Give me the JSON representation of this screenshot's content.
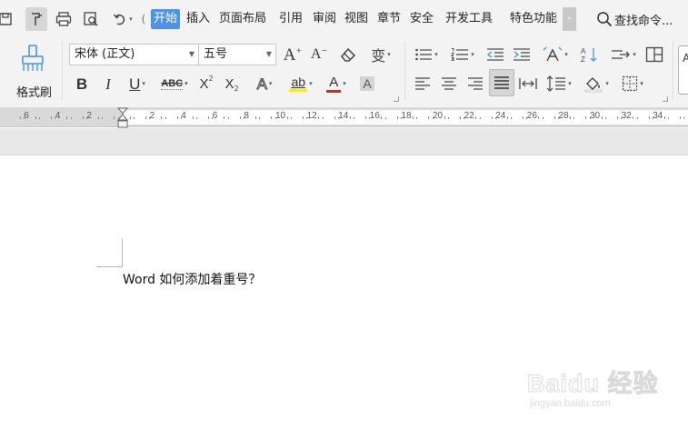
{
  "menubar": {
    "tabs": [
      "开始",
      "插入",
      "页面布局",
      "引用",
      "审阅",
      "视图",
      "章节",
      "安全",
      "开发工具",
      "特色功能"
    ],
    "active_tab": "开始",
    "search_label": "查找命令..."
  },
  "ribbon": {
    "format_painter_label": "格式刷",
    "font_name": "宋体 (正文)",
    "font_size": "五号",
    "glyphs": {
      "grow_font": "A",
      "shrink_font": "A",
      "bold": "B",
      "italic": "I",
      "underline": "U",
      "strike": "ABC",
      "superscript": "X",
      "superscript_mark": "2",
      "subscript": "X",
      "subscript_mark": "2",
      "text_effect": "A",
      "highlight": "ab",
      "font_color": "A",
      "char_shading": "A",
      "phonetic": "变"
    },
    "colors": {
      "font_color_bar": "#e02020",
      "highlight_bar": "#f6e733",
      "accent": "#4c93e8"
    }
  },
  "ruler": {
    "left_labels": [
      "6",
      "4",
      "2"
    ],
    "right_labels": [
      "2",
      "4",
      "6",
      "8",
      "10",
      "12",
      "14",
      "16",
      "18",
      "20",
      "22",
      "24",
      "26",
      "28",
      "30",
      "32",
      "34"
    ]
  },
  "document": {
    "text": "Word 如何添加着重号？"
  },
  "watermark": {
    "brand": "Baidu 经验",
    "url": "jingyan.baidu.com"
  }
}
